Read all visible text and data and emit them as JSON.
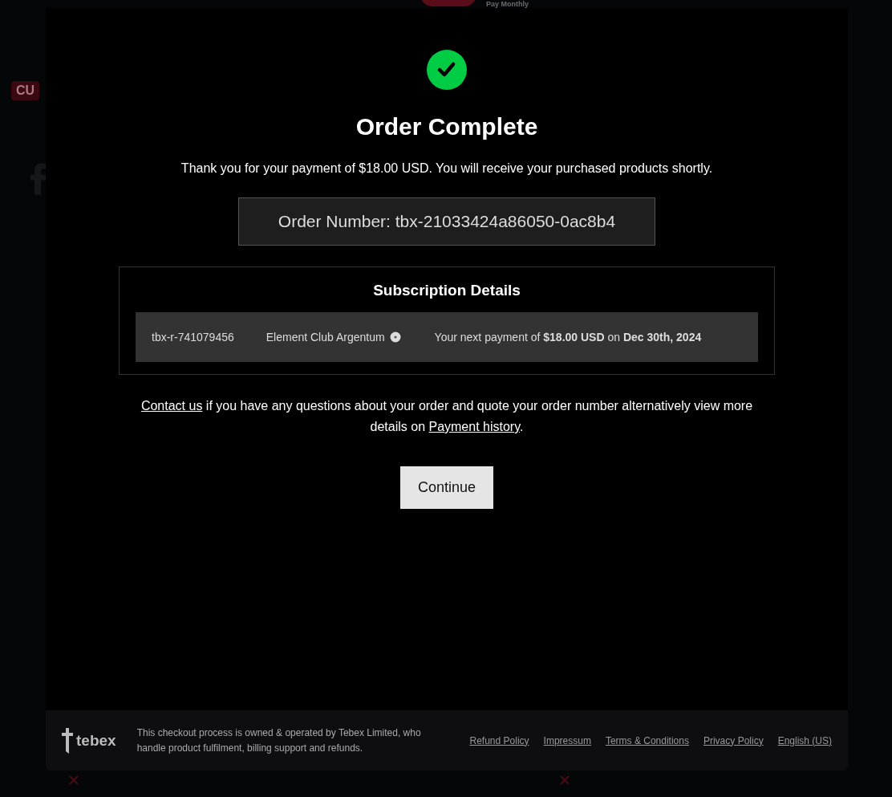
{
  "backdrop": {
    "toggle_label": "Pay Monthly",
    "toggle_on": true,
    "badge": "CU"
  },
  "modal": {
    "title": "Order Complete",
    "message": "Thank you for your payment of $18.00 USD. You will receive your purchased products shortly.",
    "order_number": "Order Number: tbx-21033424a86050-0ac8b4",
    "subscription": {
      "title": "Subscription Details",
      "id": "tbx-r-741079456",
      "product": "Element Club Argentum",
      "next_payment": "Your next payment of **$18.00 USD** on **Dec 30th, 2024**"
    },
    "help": [
      {
        "kind": "link",
        "text": "Contact us"
      },
      {
        "kind": "text",
        "text": " if you have any questions about your order and quote your order number alternatively view more details on "
      },
      {
        "kind": "link",
        "text": "Payment history"
      },
      {
        "kind": "text",
        "text": "."
      }
    ],
    "continue_button": "Continue"
  },
  "footer": {
    "logo": "tebex",
    "notice": "This checkout process is owned & operated by Tebex Limited, who handle product fulfilment, billing support and refunds.",
    "links": [
      "Refund Policy",
      "Impressum",
      "Terms & Conditions",
      "Privacy Policy",
      "English (US)"
    ]
  }
}
